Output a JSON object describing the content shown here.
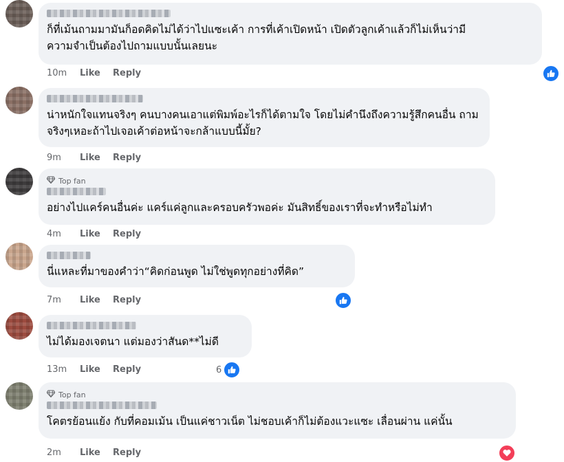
{
  "comments": [
    {
      "time": "10m",
      "like_label": "Like",
      "reply_label": "Reply",
      "top_fan": false,
      "lines": [
        "ก็ที่เม้นถามมามันก็อดคิดไม่ได้ว่าไปแซะเค้า การที่เค้าเปิดหน้า เปิดตัวลูกเค้าแล้วก็ไม่เห็นว่ามี",
        "ความจำเป็นต้องไปถามแบบนั้นเลยนะ"
      ],
      "reaction": "like",
      "reaction_count": "",
      "avatar_color": "#6b5e58"
    },
    {
      "time": "9m",
      "like_label": "Like",
      "reply_label": "Reply",
      "top_fan": false,
      "lines": [
        "น่าหนักใจแทนจริงๆ คนบางคนเอาแต่พิมพ์อะไรก็ได้ตามใจ โดยไม่คำนึงถึงความรู้สึกคนอื่น ถาม",
        "จริงๆเหอะถ้าไปเจอเค้าต่อหน้าจะกล้าแบบนี้มั้ย?"
      ],
      "reaction": "",
      "reaction_count": "",
      "avatar_color": "#8a6f64"
    },
    {
      "time": "4m",
      "like_label": "Like",
      "reply_label": "Reply",
      "top_fan": true,
      "top_fan_label": "Top fan",
      "lines": [
        "อย่างไปแคร์คนอื่นค่ะ แคร์แค่ลูกและครอบครัวพอค่ะ มันสิทธิ์ของเราที่จะทำหรือไม่ทำ"
      ],
      "reaction": "",
      "reaction_count": "",
      "avatar_color": "#3d3b3c"
    },
    {
      "time": "7m",
      "like_label": "Like",
      "reply_label": "Reply",
      "top_fan": false,
      "lines": [
        "นี่แหละที่มาของคำว่า“คิดก่อนพูด ไม่ใช่พูดทุกอย่างที่คิด”"
      ],
      "reaction": "like",
      "reaction_count": "",
      "avatar_color": "#c9a58c"
    },
    {
      "time": "13m",
      "like_label": "Like",
      "reply_label": "Reply",
      "top_fan": false,
      "lines": [
        "ไม่ได้มองเจตนา แต่มองว่าสันด**ไม่ดี"
      ],
      "reaction": "like",
      "reaction_count": "6",
      "avatar_color": "#9c4b3f"
    },
    {
      "time": "2m",
      "like_label": "Like",
      "reply_label": "Reply",
      "top_fan": true,
      "top_fan_label": "Top fan",
      "lines": [
        "โคตรย้อนแย้ง กับที่คอมเม้น เป็นแค่ชาวเน็ต ไม่ชอบเค้าก็ไม่ต้องแวะแซะ เลื่อนผ่าน แค่นั้น"
      ],
      "reaction": "love",
      "reaction_count": "",
      "avatar_color": "#7e8070"
    }
  ],
  "colors": {
    "like": "#1877f2",
    "love": "#f33e58",
    "bubble": "#f0f2f5",
    "meta": "#65676b"
  },
  "icons": {
    "like": "thumbs-up-icon",
    "love": "heart-icon",
    "top_fan": "diamond-icon"
  }
}
